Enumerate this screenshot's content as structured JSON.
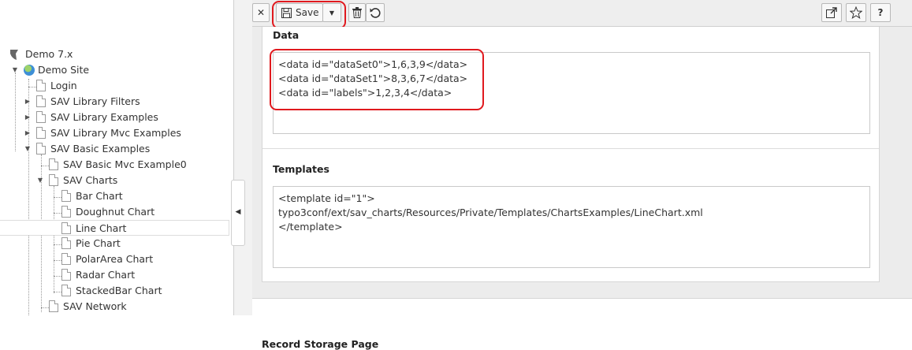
{
  "toolbar": {
    "close_label": "✕",
    "save_label": "Save",
    "save_icon": "floppy-disk-icon",
    "dropdown_icon": "caret-down-icon",
    "delete_icon": "trash-icon",
    "undo_icon": "undo-icon",
    "open_new_window_icon": "external-link-icon",
    "bookmark_icon": "star-icon",
    "help_label": "?"
  },
  "tree": {
    "root": "Demo 7.x",
    "site": "Demo Site",
    "items": [
      {
        "label": "Login"
      },
      {
        "label": "SAV Library Filters"
      },
      {
        "label": "SAV Library Examples"
      },
      {
        "label": "SAV Library Mvc Examples"
      },
      {
        "label": "SAV Basic Examples"
      },
      {
        "label": "SAV Basic Mvc Example0"
      },
      {
        "label": "SAV Charts"
      },
      {
        "label": "Bar Chart"
      },
      {
        "label": "Doughnut Chart"
      },
      {
        "label": "Line Chart"
      },
      {
        "label": "Pie Chart"
      },
      {
        "label": "PolarArea Chart"
      },
      {
        "label": "Radar Chart"
      },
      {
        "label": "StackedBar Chart"
      },
      {
        "label": "SAV Network"
      }
    ]
  },
  "form": {
    "data_title": "Data",
    "data_content": "<data id=\"dataSet0\">1,6,3,9</data>\n<data id=\"dataSet1\">8,3,6,7</data>\n<data id=\"labels\">1,2,3,4</data>",
    "templates_title": "Templates",
    "templates_content": "<template id=\"1\">\ntypo3conf/ext/sav_charts/Resources/Private/Templates/ChartsExamples/LineChart.xml\n</template>",
    "next_section_title": "Record Storage Page"
  },
  "colors": {
    "highlight": "#e0191e",
    "toolbar_bg": "#eeeeee"
  }
}
